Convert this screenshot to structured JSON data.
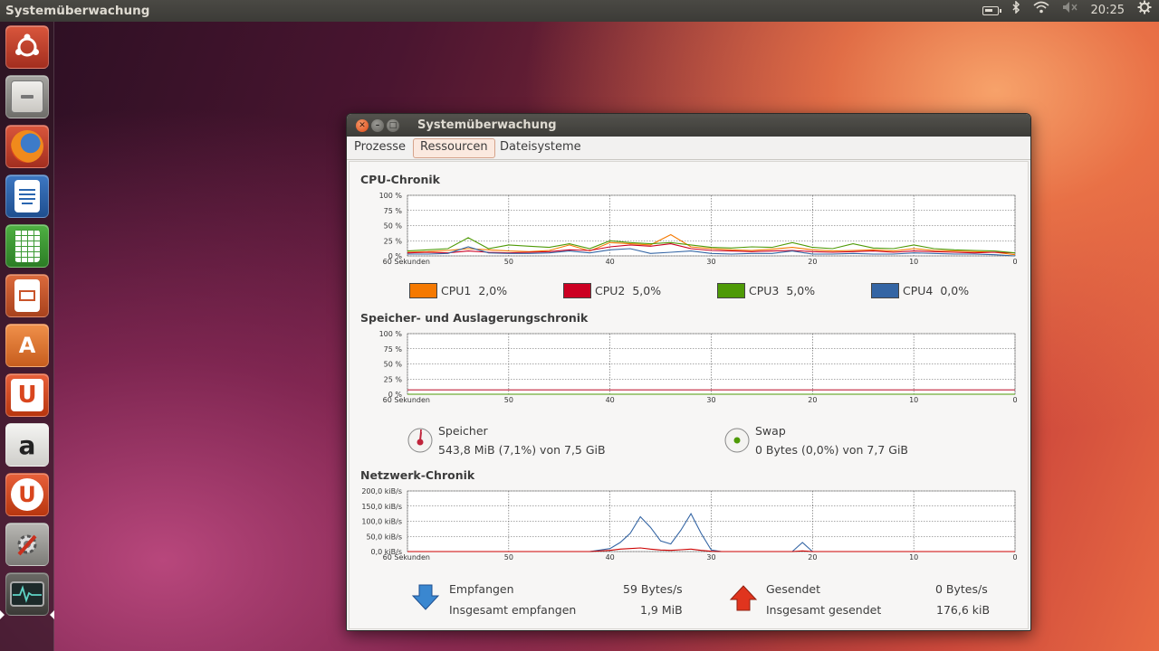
{
  "panel": {
    "app_title": "Systemüberwachung",
    "clock": "20:25"
  },
  "launcher": {
    "items": [
      {
        "name": "ubuntu-dash",
        "color": "#c2412b"
      },
      {
        "name": "files",
        "color": "#8a8a88"
      },
      {
        "name": "firefox",
        "color": "#e66000"
      },
      {
        "name": "libreoffice-writer",
        "color": "#2a66b0"
      },
      {
        "name": "libreoffice-calc",
        "color": "#3d9b35"
      },
      {
        "name": "libreoffice-impress",
        "color": "#c9542a"
      },
      {
        "name": "software-center",
        "color": "#e07a30"
      },
      {
        "name": "ubuntu-one",
        "color": "#d9461e"
      },
      {
        "name": "amazon",
        "color": "#333333"
      },
      {
        "name": "ubuntu-one-music",
        "color": "#d9461e"
      },
      {
        "name": "system-settings",
        "color": "#9a9a98"
      },
      {
        "name": "system-monitor",
        "color": "#444444"
      }
    ]
  },
  "window": {
    "title": "Systemüberwachung",
    "tabs": [
      {
        "label": "Prozesse",
        "active": false
      },
      {
        "label": "Ressourcen",
        "active": true
      },
      {
        "label": "Dateisysteme",
        "active": false
      }
    ]
  },
  "cpu": {
    "title": "CPU-Chronik",
    "legend": [
      {
        "label": "CPU1",
        "value": "2,0%",
        "color": "#f57900"
      },
      {
        "label": "CPU2",
        "value": "5,0%",
        "color": "#cc0022"
      },
      {
        "label": "CPU3",
        "value": "5,0%",
        "color": "#4e9a06"
      },
      {
        "label": "CPU4",
        "value": "0,0%",
        "color": "#3465a4"
      }
    ]
  },
  "memory": {
    "title": "Speicher- und Auslagerungschronik",
    "speicher_label": "Speicher",
    "speicher_value": "543,8 MiB (7,1%) von 7,5 GiB",
    "speicher_color": "#c0243b",
    "swap_label": "Swap",
    "swap_value": "0 Bytes (0,0%) von 7,7 GiB",
    "swap_color": "#4e9a06"
  },
  "network": {
    "title": "Netzwerk-Chronik",
    "received_label": "Empfangen",
    "received_value": "59 Bytes/s",
    "total_received_label": "Insgesamt empfangen",
    "total_received_value": "1,9 MiB",
    "sent_label": "Gesendet",
    "sent_value": "0 Bytes/s",
    "total_sent_label": "Insgesamt gesendet",
    "total_sent_value": "176,6 kiB"
  },
  "chart_data": [
    {
      "type": "line",
      "title": "CPU-Chronik",
      "x_tick_labels": [
        "60 Sekunden",
        "50",
        "40",
        "30",
        "20",
        "10",
        "0"
      ],
      "y_tick_labels": [
        "100 %",
        "75 %",
        "50 %",
        "25 %",
        "0 %"
      ],
      "x": [
        60,
        58,
        56,
        54,
        52,
        50,
        48,
        46,
        44,
        42,
        40,
        38,
        36,
        34,
        32,
        30,
        28,
        26,
        24,
        22,
        20,
        18,
        16,
        14,
        12,
        10,
        8,
        6,
        4,
        2,
        0
      ],
      "ylim": [
        0,
        100
      ],
      "series": [
        {
          "name": "CPU1",
          "values": [
            6,
            7,
            9,
            12,
            10,
            8,
            7,
            9,
            18,
            8,
            22,
            20,
            18,
            35,
            15,
            12,
            10,
            9,
            11,
            14,
            10,
            8,
            9,
            10,
            8,
            12,
            9,
            8,
            7,
            6,
            2
          ]
        },
        {
          "name": "CPU2",
          "values": [
            5,
            6,
            5,
            8,
            6,
            5,
            6,
            7,
            10,
            9,
            15,
            18,
            16,
            20,
            12,
            9,
            8,
            7,
            8,
            9,
            7,
            6,
            7,
            8,
            6,
            8,
            7,
            6,
            5,
            6,
            5
          ]
        },
        {
          "name": "CPU3",
          "values": [
            8,
            10,
            12,
            30,
            12,
            18,
            16,
            14,
            20,
            12,
            25,
            22,
            20,
            22,
            18,
            14,
            13,
            15,
            14,
            22,
            14,
            12,
            20,
            13,
            12,
            18,
            12,
            10,
            9,
            8,
            5
          ]
        },
        {
          "name": "CPU4",
          "values": [
            3,
            3,
            4,
            15,
            5,
            4,
            4,
            5,
            8,
            5,
            10,
            12,
            4,
            6,
            8,
            4,
            3,
            4,
            4,
            8,
            3,
            3,
            4,
            3,
            3,
            5,
            4,
            3,
            3,
            2,
            0
          ]
        }
      ]
    },
    {
      "type": "line",
      "title": "Speicher- und Auslagerungschronik",
      "x_tick_labels": [
        "60 Sekunden",
        "50",
        "40",
        "30",
        "20",
        "10",
        "0"
      ],
      "y_tick_labels": [
        "100 %",
        "75 %",
        "50 %",
        "25 %",
        "0 %"
      ],
      "x": [
        60,
        0
      ],
      "ylim": [
        0,
        100
      ],
      "series": [
        {
          "name": "Speicher",
          "values": [
            7.1,
            7.1
          ]
        },
        {
          "name": "Swap",
          "values": [
            0,
            0
          ]
        }
      ]
    },
    {
      "type": "line",
      "title": "Netzwerk-Chronik",
      "x_tick_labels": [
        "60 Sekunden",
        "50",
        "40",
        "30",
        "20",
        "10",
        "0"
      ],
      "y_tick_labels": [
        "200,0 kiB/s",
        "150,0 kiB/s",
        "100,0 kiB/s",
        "50,0 kiB/s",
        "0,0 kiB/s"
      ],
      "x": [
        60,
        42,
        40,
        39,
        38,
        37,
        36,
        35,
        34,
        33,
        32,
        31,
        30,
        29,
        22,
        21,
        20,
        0
      ],
      "ylim": [
        0,
        200
      ],
      "series": [
        {
          "name": "Empfangen",
          "values": [
            0,
            0,
            10,
            30,
            60,
            115,
            80,
            35,
            25,
            70,
            125,
            60,
            5,
            0,
            0,
            30,
            0,
            0
          ]
        },
        {
          "name": "Gesendet",
          "values": [
            0,
            0,
            4,
            8,
            10,
            12,
            8,
            5,
            4,
            6,
            8,
            4,
            1,
            0,
            0,
            2,
            0,
            0
          ]
        }
      ]
    }
  ]
}
